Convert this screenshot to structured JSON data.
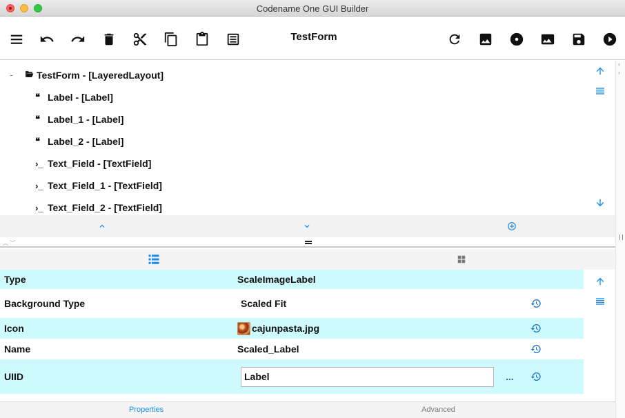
{
  "window": {
    "title": "Codename One GUI Builder"
  },
  "toolbar": {
    "title": "TestForm",
    "left_icons": [
      "menu-icon",
      "undo-icon",
      "redo-icon",
      "delete-icon",
      "cut-icon",
      "copy-icon",
      "paste-icon",
      "clipboard-list-icon"
    ],
    "right_icons": [
      "refresh-icon",
      "image-icon",
      "disc-icon",
      "photo-icon",
      "save-icon",
      "play-icon"
    ]
  },
  "tree": {
    "collapse_glyph": "-",
    "root": {
      "label": "TestForm - [LayeredLayout]",
      "icon": "folder-open-icon"
    },
    "items": [
      {
        "label": "Label - [Label]",
        "icon": "quote-icon",
        "glyph": "❝"
      },
      {
        "label": "Label_1 - [Label]",
        "icon": "quote-icon",
        "glyph": "❝"
      },
      {
        "label": "Label_2 - [Label]",
        "icon": "quote-icon",
        "glyph": "❝"
      },
      {
        "label": "Text_Field - [TextField]",
        "icon": "terminal-icon",
        "glyph": "›_"
      },
      {
        "label": "Text_Field_1 - [TextField]",
        "icon": "terminal-icon",
        "glyph": "›_"
      },
      {
        "label": "Text_Field_2 - [TextField]",
        "icon": "terminal-icon",
        "glyph": "›_"
      }
    ]
  },
  "properties": {
    "rows": [
      {
        "key": "Type",
        "value": "ScaleImageLabel"
      },
      {
        "key": "Background Type",
        "value": "Scaled Fit"
      },
      {
        "key": "Icon",
        "value": "cajunpasta.jpg"
      },
      {
        "key": "Name",
        "value": "Scaled_Label"
      },
      {
        "key": "UIID",
        "value": "Label",
        "more": "..."
      }
    ]
  },
  "bottom_tabs": {
    "properties": "Properties",
    "advanced": "Advanced"
  },
  "colors": {
    "accent": "#1a8ce6",
    "row_highlight": "#cefafd",
    "reset_blue": "#1a6fc6"
  }
}
